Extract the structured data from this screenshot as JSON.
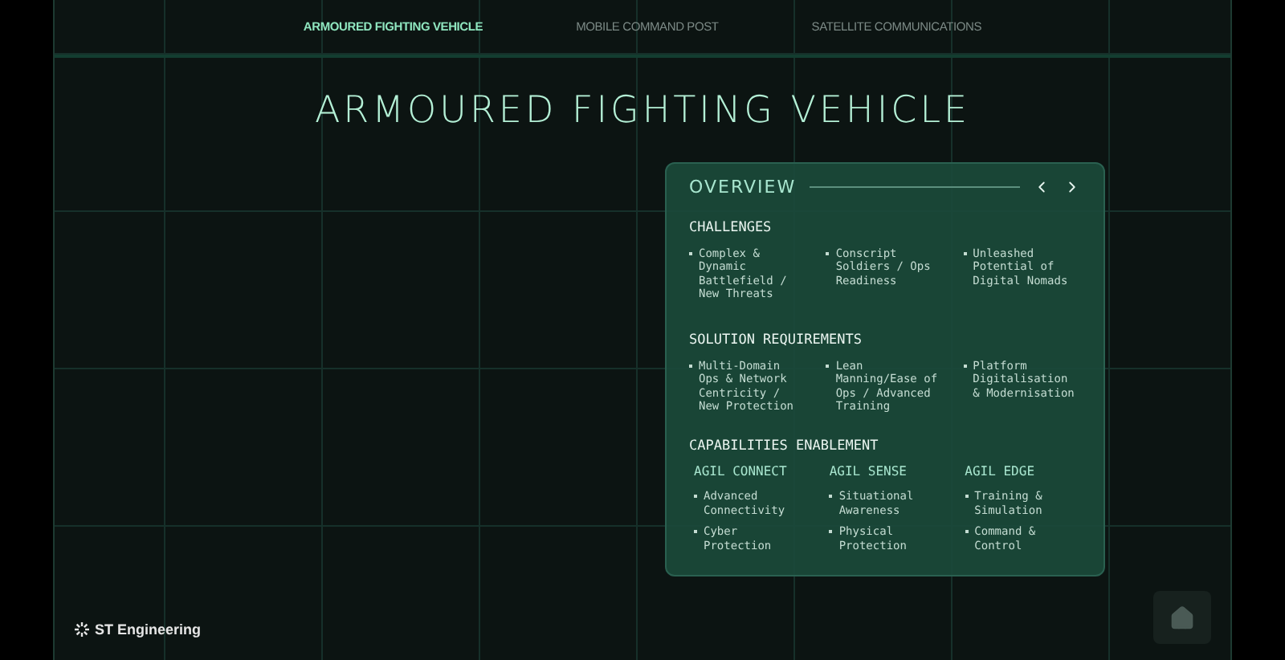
{
  "nav": {
    "tabs": [
      {
        "label": "ARMOURED FIGHTING VEHICLE",
        "selected": true
      },
      {
        "label": "MOBILE COMMAND POST",
        "selected": false
      },
      {
        "label": "SATELLITE COMMUNICATIONS",
        "selected": false
      }
    ]
  },
  "title": "ARMOURED FIGHTING VEHICLE",
  "overview": {
    "title": "OVERVIEW",
    "sections": [
      {
        "heading": "CHALLENGES",
        "items": [
          "Complex & Dynamic Battlefield / New Threats",
          "Conscript Soldiers / Ops Readiness",
          "Unleashed Potential of Digital Nomads"
        ]
      },
      {
        "heading": "SOLUTION REQUIREMENTS",
        "items": [
          "Multi-Domain Ops & Network Centricity / New Protection",
          "Lean Manning/Ease of Ops / Advanced Training",
          "Platform Digitalisation & Modernisation"
        ]
      }
    ],
    "capabilities": {
      "heading": "CAPABILITIES ENABLEMENT",
      "groups": [
        {
          "heading": "AGIL CONNECT",
          "items": [
            "Advanced Connectivity",
            "Cyber Protection"
          ]
        },
        {
          "heading": "AGIL SENSE",
          "items": [
            "Situational Awareness",
            "Physical Protection"
          ]
        },
        {
          "heading": "AGIL EDGE",
          "items": [
            "Training & Simulation",
            "Command & Control"
          ]
        }
      ]
    }
  },
  "footer": {
    "logo": "ST Engineering"
  }
}
